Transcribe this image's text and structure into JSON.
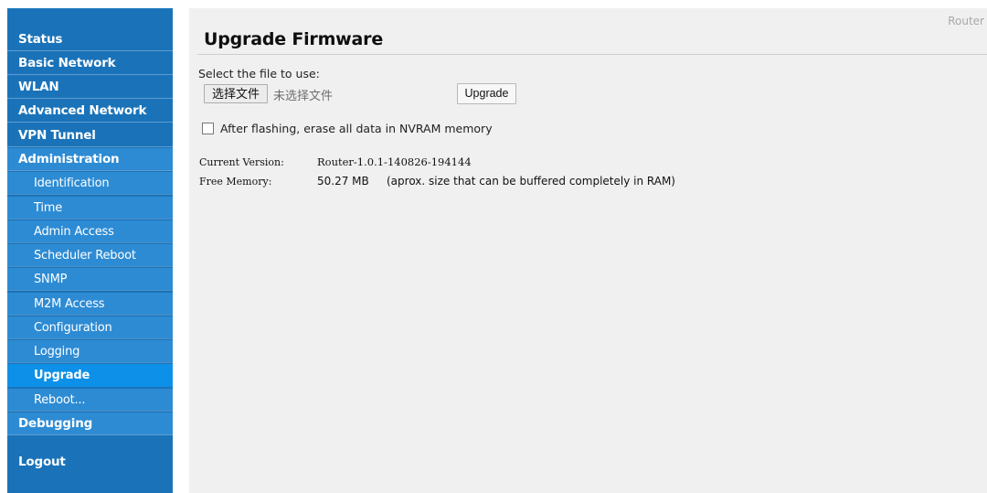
{
  "sidebar": {
    "main_items": [
      {
        "label": "Status"
      },
      {
        "label": "Basic Network"
      },
      {
        "label": "WLAN"
      },
      {
        "label": "Advanced Network"
      },
      {
        "label": "VPN Tunnel"
      },
      {
        "label": "Administration"
      }
    ],
    "admin_subitems": [
      {
        "label": "Identification"
      },
      {
        "label": "Time"
      },
      {
        "label": "Admin Access"
      },
      {
        "label": "Scheduler Reboot"
      },
      {
        "label": "SNMP"
      },
      {
        "label": "M2M Access"
      },
      {
        "label": "Configuration"
      },
      {
        "label": "Logging"
      },
      {
        "label": "Upgrade"
      },
      {
        "label": "Reboot..."
      }
    ],
    "debugging": {
      "label": "Debugging"
    },
    "logout": {
      "label": "Logout"
    },
    "active_item": "Upgrade"
  },
  "header": {
    "brand": "Router",
    "title": "Upgrade Firmware"
  },
  "upload": {
    "label": "Select the file to use:",
    "choose_button": "选择文件",
    "file_status": "未选择文件",
    "upgrade_button": "Upgrade"
  },
  "erase": {
    "label": "After flashing, erase all data in NVRAM memory",
    "checked": false
  },
  "info": {
    "current_version_label": "Current Version:",
    "current_version_value": "Router-1.0.1-140826-194144",
    "free_memory_label": "Free Memory:",
    "free_memory_value": "50.27 MB",
    "free_memory_note": "(aprox. size that can be buffered completely in RAM)"
  },
  "colors": {
    "sidebar_bg": "#1a73b9",
    "section_active_bg": "#2d8bd3",
    "item_active_bg": "#0d90e8",
    "content_bg": "#f0f0f0"
  }
}
